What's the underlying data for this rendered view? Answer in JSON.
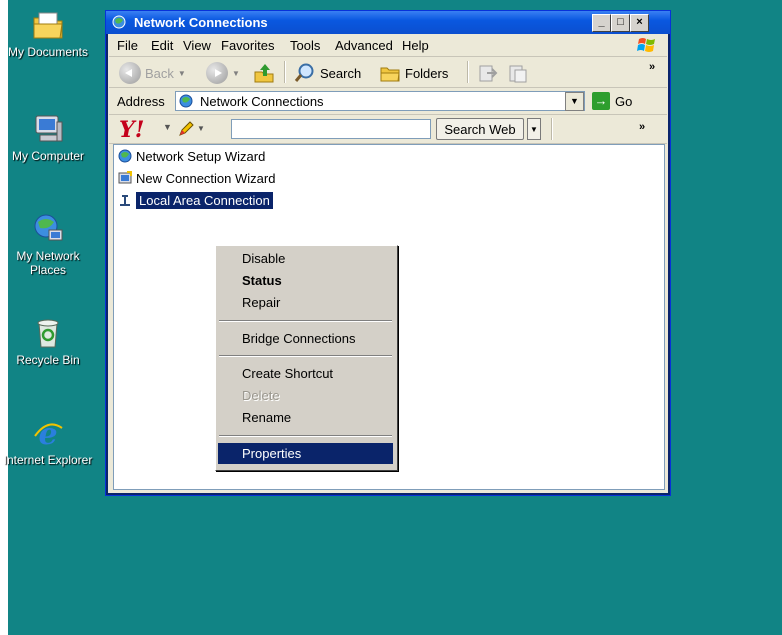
{
  "desktop": {
    "icons": [
      {
        "label": "My Documents",
        "icon": "my-documents-icon"
      },
      {
        "label": "My Computer",
        "icon": "my-computer-icon"
      },
      {
        "label": "My Network Places",
        "icon": "my-network-places-icon"
      },
      {
        "label": "Recycle Bin",
        "icon": "recycle-bin-icon"
      },
      {
        "label": "Internet Explorer",
        "icon": "internet-explorer-icon"
      }
    ]
  },
  "window": {
    "title": "Network Connections",
    "caption_buttons": {
      "minimize": "_",
      "maximize": "□",
      "close": "×"
    }
  },
  "menubar": {
    "items": [
      "File",
      "Edit",
      "View",
      "Favorites",
      "Tools",
      "Advanced",
      "Help"
    ]
  },
  "toolbar": {
    "back_label": "Back",
    "search_label": "Search",
    "folders_label": "Folders",
    "chevron": "»"
  },
  "addressbar": {
    "label": "Address",
    "value": "Network Connections",
    "go_label": "Go"
  },
  "yahoobar": {
    "logo": "Y!",
    "search_input_value": "",
    "search_button_label": "Search Web",
    "chevron": "»"
  },
  "files": [
    {
      "label": "Network Setup Wizard",
      "icon": "network-setup-wizard-icon"
    },
    {
      "label": "New Connection Wizard",
      "icon": "new-connection-wizard-icon"
    },
    {
      "label": "Local Area Connection",
      "icon": "local-area-connection-icon",
      "selected": true
    }
  ],
  "context_menu": {
    "items": [
      {
        "label": "Disable"
      },
      {
        "label": "Status",
        "bold": true
      },
      {
        "label": "Repair"
      },
      {
        "label": "Bridge Connections"
      },
      {
        "label": "Create Shortcut"
      },
      {
        "label": "Delete",
        "disabled": true
      },
      {
        "label": "Rename"
      },
      {
        "label": "Properties",
        "highlighted": true
      }
    ]
  },
  "colors": {
    "desktop": "#118485",
    "titlebar": "#0a58e0",
    "selection": "#0a246a"
  }
}
